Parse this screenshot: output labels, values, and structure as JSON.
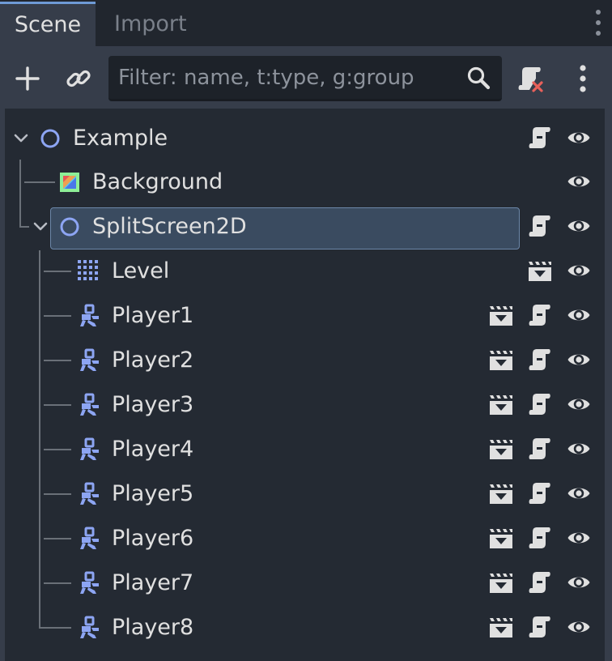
{
  "tabs": [
    {
      "label": "Scene",
      "active": true
    },
    {
      "label": "Import",
      "active": false
    }
  ],
  "toolbar": {
    "add_icon": "plus-icon",
    "link_icon": "link-icon",
    "filter_placeholder": "Filter: name, t:type, g:group",
    "filter_value": "",
    "search_icon": "search-icon",
    "script_icon": "script-remove-icon",
    "menu_icon": "kebab-menu-icon"
  },
  "colors": {
    "panel_bg": "#363d4a",
    "tree_bg": "#242a33",
    "selection_bg": "#3a4b60",
    "node_icon": "#8da5f3",
    "text": "#e0e0e0"
  },
  "tree": {
    "root": {
      "label": "Example",
      "icon": "node2d-circle-icon",
      "expanded": true
    },
    "background": {
      "label": "Background",
      "icon": "colorrect-icon"
    },
    "splitscreen": {
      "label": "SplitScreen2D",
      "icon": "node2d-circle-icon",
      "expanded": true,
      "selected": true
    },
    "level": {
      "label": "Level",
      "icon": "tilemap-icon"
    },
    "players": [
      {
        "label": "Player1",
        "icon": "characterbody2d-icon"
      },
      {
        "label": "Player2",
        "icon": "characterbody2d-icon"
      },
      {
        "label": "Player3",
        "icon": "characterbody2d-icon"
      },
      {
        "label": "Player4",
        "icon": "characterbody2d-icon"
      },
      {
        "label": "Player5",
        "icon": "characterbody2d-icon"
      },
      {
        "label": "Player6",
        "icon": "characterbody2d-icon"
      },
      {
        "label": "Player7",
        "icon": "characterbody2d-icon"
      },
      {
        "label": "Player8",
        "icon": "characterbody2d-icon"
      }
    ]
  }
}
